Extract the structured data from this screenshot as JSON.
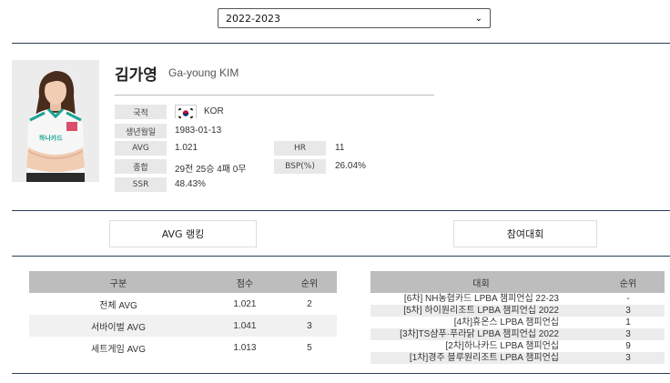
{
  "season_select": {
    "value": "2022-2023"
  },
  "player": {
    "name_ko": "김가영",
    "name_en": "Ga-young KIM",
    "jersey_text": "하나카드",
    "info": {
      "nationality_label": "국적",
      "nationality_value": "KOR",
      "birth_label": "생년월일",
      "birth_value": "1983-01-13",
      "avg_label": "AVG",
      "avg_value": "1.021",
      "hr_label": "HR",
      "hr_value": "11",
      "record_label": "종합",
      "record_value": "29전 25승 4패 0무",
      "bsp_label": "BSP(%)",
      "bsp_value": "26.04%",
      "ssr_label": "SSR",
      "ssr_value": "48.43%"
    }
  },
  "tabs": {
    "avg_ranking": "AVG 랭킹",
    "tournaments": "참여대회"
  },
  "avg_table": {
    "headers": [
      "구분",
      "점수",
      "순위"
    ],
    "rows": [
      {
        "category": "전체 AVG",
        "score": "1.021",
        "rank": "2"
      },
      {
        "category": "서바이벌 AVG",
        "score": "1.041",
        "rank": "3"
      },
      {
        "category": "세트게임 AVG",
        "score": "1.013",
        "rank": "5"
      }
    ]
  },
  "tournament_table": {
    "headers": [
      "대회",
      "순위"
    ],
    "rows": [
      {
        "name": "[6차] NH농협카드 LPBA 챔피언십 22-23",
        "rank": "-"
      },
      {
        "name": "[5차] 하이원리조트 LPBA 챔피언십 2022",
        "rank": "3"
      },
      {
        "name": "[4차]휴온스 LPBA 챔피언십",
        "rank": "1"
      },
      {
        "name": "[3차]TS샴푸·푸라닭 LPBA 챔피언십 2022",
        "rank": "3"
      },
      {
        "name": "[2차]하나카드 LPBA 챔피언십",
        "rank": "9"
      },
      {
        "name": "[1차]경주 블루원리조트 LPBA 챔피언십",
        "rank": "3"
      }
    ]
  },
  "colors": {
    "rule": "#2c3e55",
    "label_bg": "#e8e8e8",
    "header_bg": "#bdbdbd"
  }
}
